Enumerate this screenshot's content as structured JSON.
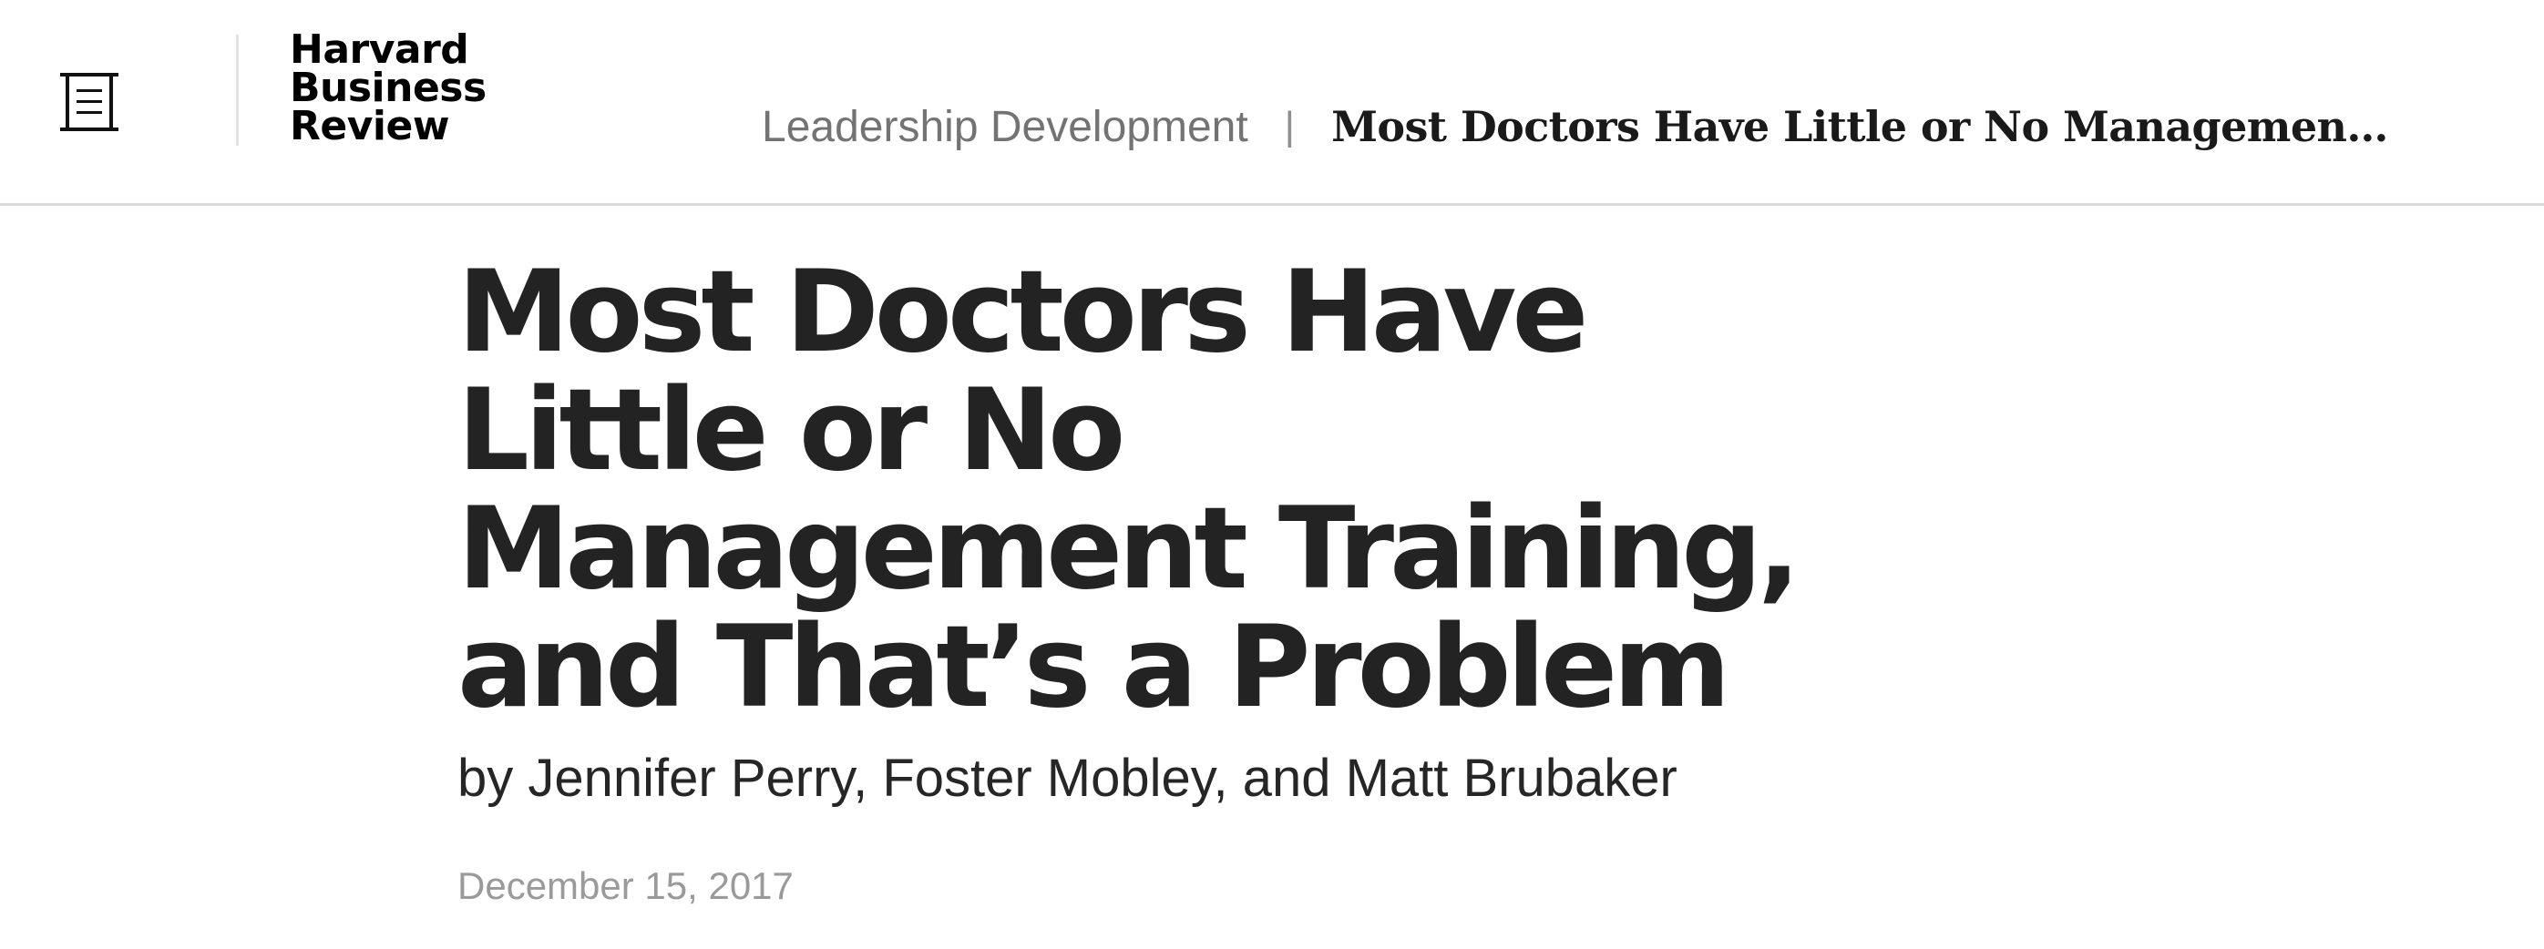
{
  "header": {
    "menu_icon": "menu-icon",
    "logo": {
      "line1": "Harvard",
      "line2": "Business",
      "line3": "Review"
    },
    "breadcrumb": {
      "section": "Leadership Development",
      "separator": "|",
      "title": "Most Doctors Have Little or No Management Training, and That’s a Problem"
    }
  },
  "article": {
    "title": "Most Doctors Have Little or No Management Training, and That’s a Problem",
    "byline": "by Jennifer Perry, Foster Mobley, and Matt Brubaker",
    "date": "December 15, 2017"
  }
}
